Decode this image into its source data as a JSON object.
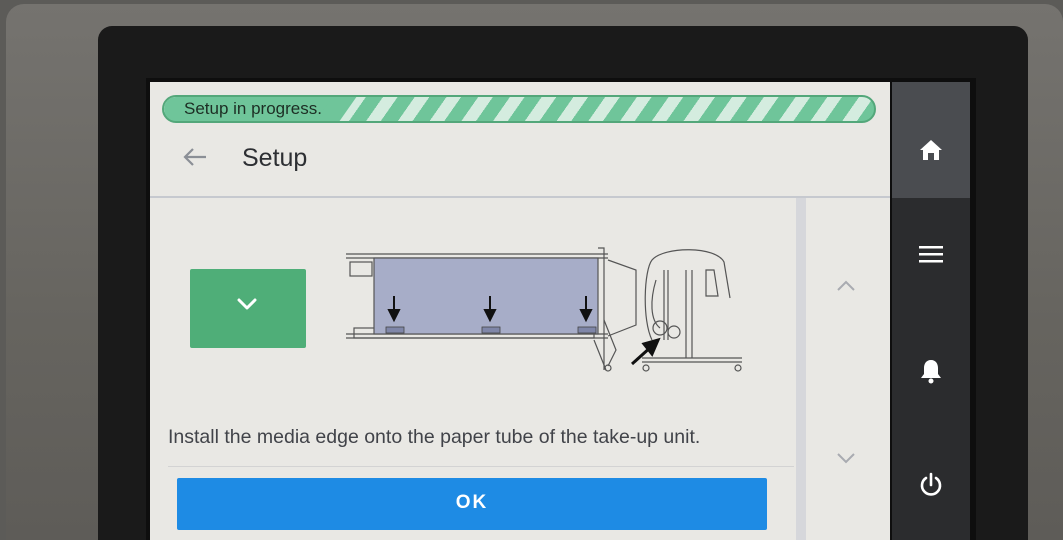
{
  "status": {
    "progress_label": "Setup in progress."
  },
  "header": {
    "title": "Setup"
  },
  "main": {
    "instruction": "Install the media edge onto the paper tube of the take-up unit.",
    "ok_label": "OK"
  },
  "icons": {
    "back": "back-arrow-icon",
    "expand": "chevron-down-icon",
    "scroll_up": "chevron-up-icon",
    "scroll_down": "chevron-down-icon",
    "home": "home-icon",
    "menu": "menu-icon",
    "notifications": "bell-icon",
    "power": "power-icon"
  },
  "colors": {
    "progress_green": "#6fc59a",
    "expand_green": "#4fae78",
    "ok_blue": "#1e8be4",
    "nav_bg": "#2b2c2e"
  }
}
